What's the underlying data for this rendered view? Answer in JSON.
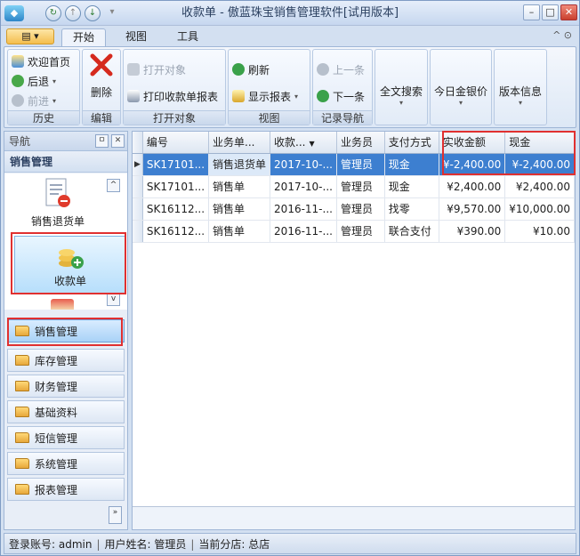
{
  "window": {
    "title": "收款单 - 傲蓝珠宝销售管理软件[试用版本]"
  },
  "tabs": [
    {
      "label": "开始",
      "active": true
    },
    {
      "label": "视图"
    },
    {
      "label": "工具"
    }
  ],
  "ribbon": {
    "history": {
      "label": "历史",
      "home": "欢迎首页",
      "back": "后退",
      "forward": "前进"
    },
    "edit": {
      "label": "编辑",
      "delete": "删除"
    },
    "open": {
      "label": "打开对象",
      "open_object": "打开对象",
      "print_report": "打印收款单报表"
    },
    "view": {
      "label": "视图",
      "refresh": "刷新",
      "show_report": "显示报表"
    },
    "record_nav": {
      "label": "记录导航",
      "prev": "上一条",
      "next": "下一条"
    },
    "search": "全文搜索",
    "gold_price": "今日金银价",
    "version": "版本信息"
  },
  "nav": {
    "header": "导航",
    "section": "销售管理",
    "items": [
      "销售退货单",
      "收款单"
    ],
    "categories": [
      "销售管理",
      "库存管理",
      "财务管理",
      "基础资料",
      "短信管理",
      "系统管理",
      "报表管理"
    ]
  },
  "grid": {
    "columns": [
      "编号",
      "业务单...",
      "收款...",
      "业务员",
      "支付方式",
      "实收金额",
      "现金"
    ],
    "rows": [
      [
        "SK17101...",
        "销售退货单",
        "2017-10-...",
        "管理员",
        "现金",
        "¥-2,400.00",
        "¥-2,400.00"
      ],
      [
        "SK17101...",
        "销售单",
        "2017-10-...",
        "管理员",
        "现金",
        "¥2,400.00",
        "¥2,400.00"
      ],
      [
        "SK16112...",
        "销售单",
        "2016-11-...",
        "管理员",
        "找零",
        "¥9,570.00",
        "¥10,000.00"
      ],
      [
        "SK16112...",
        "销售单",
        "2016-11-...",
        "管理员",
        "联合支付",
        "¥390.00",
        "¥10.00"
      ]
    ]
  },
  "status": {
    "account": "登录账号: admin",
    "user": "用户姓名: 管理员",
    "branch": "当前分店: 总店"
  }
}
